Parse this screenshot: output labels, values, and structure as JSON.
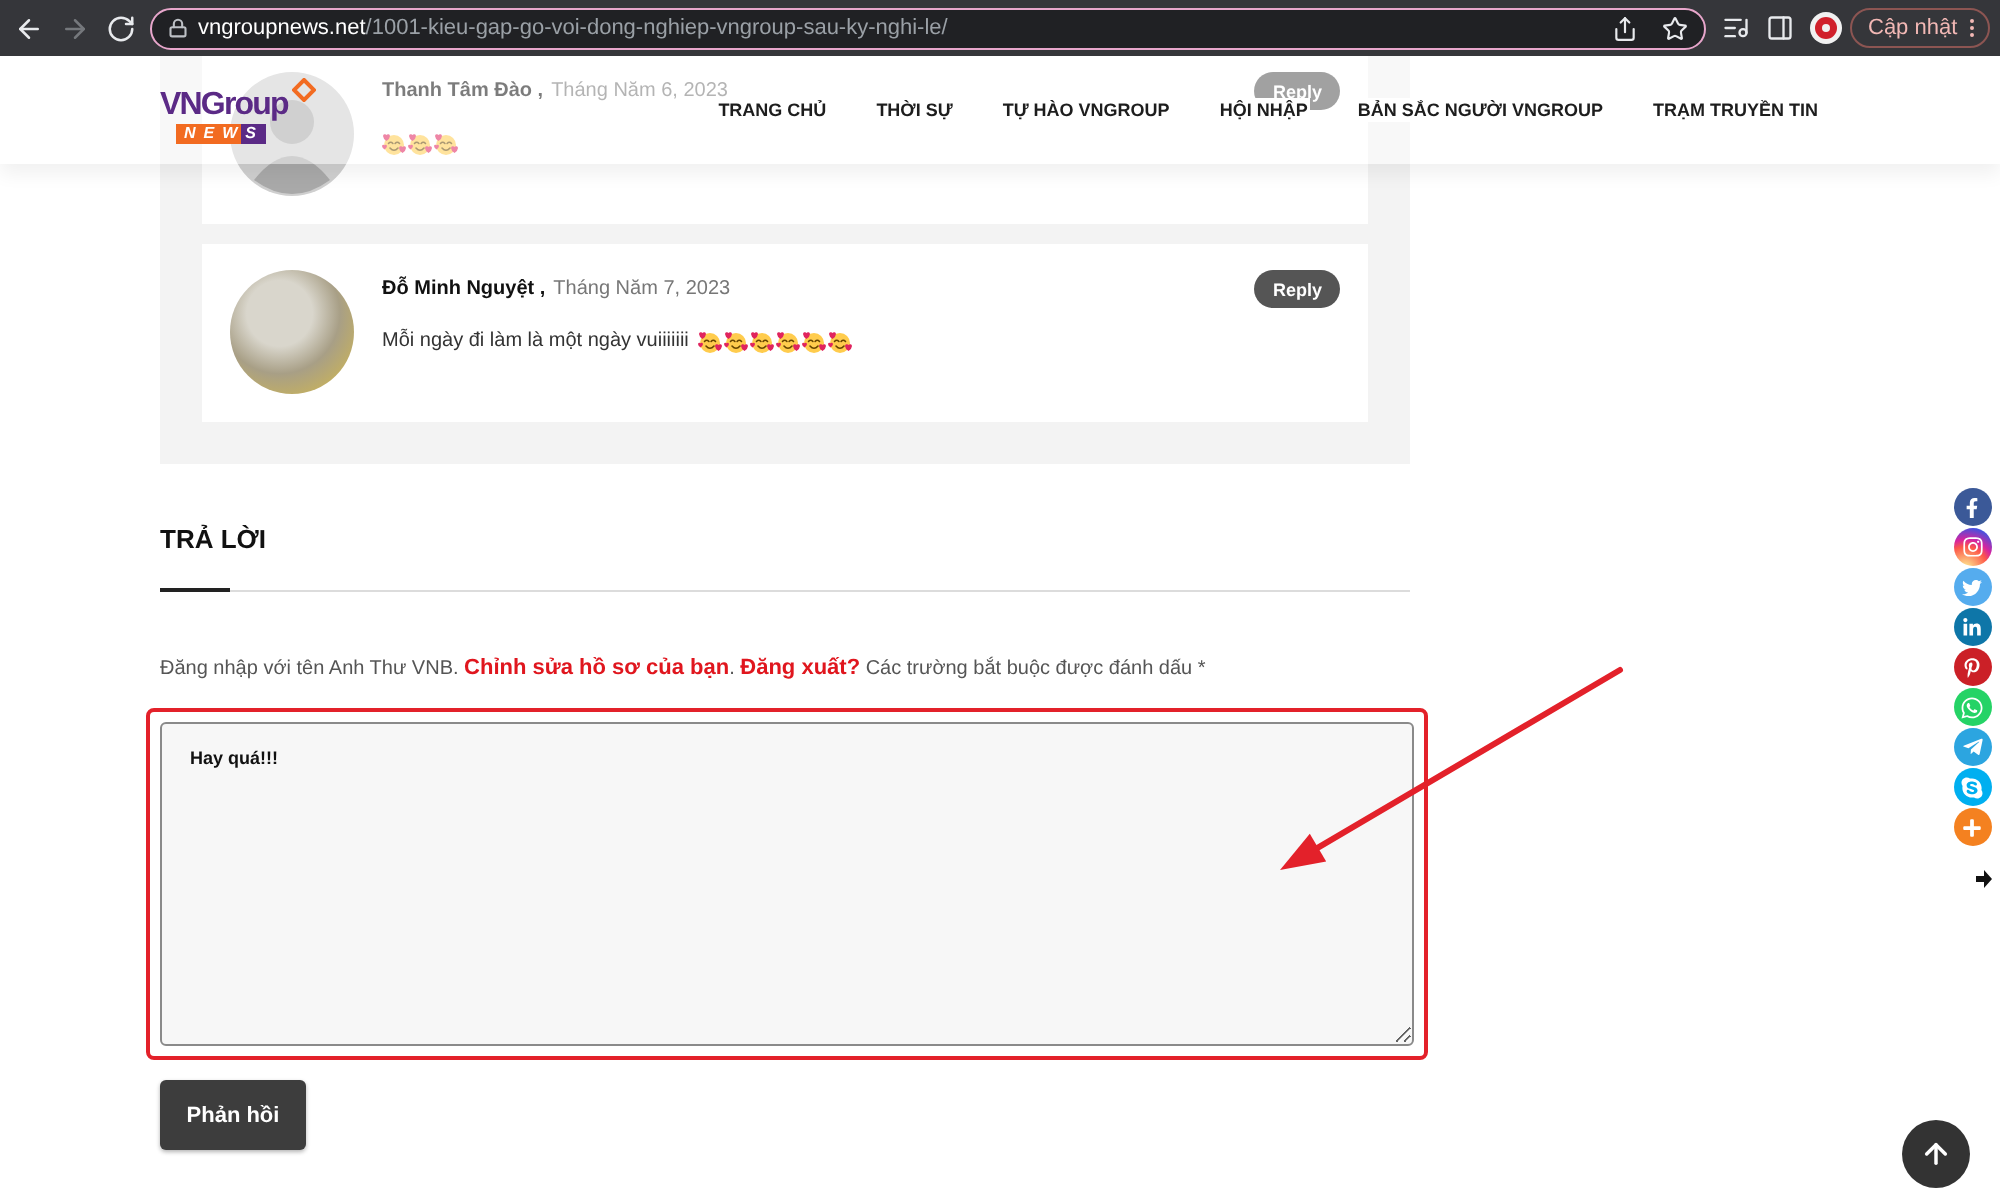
{
  "browser": {
    "nav_buttons": [
      {
        "kind": "back",
        "disabled": false
      },
      {
        "kind": "forward",
        "disabled": true
      },
      {
        "kind": "reload",
        "disabled": false
      }
    ],
    "url_domain": "vngroupnews.net",
    "url_path": "/1001-kieu-gap-go-voi-dong-nghiep-vngroup-sau-ky-nghi-le/",
    "update_button": "Cập nhật"
  },
  "header": {
    "logo": {
      "wordmark": "VNGroup",
      "tagline": "NEWS"
    },
    "nav": [
      {
        "label": "TRANG CHỦ"
      },
      {
        "label": "THỜI SỰ"
      },
      {
        "label": "TỰ HÀO VNGROUP"
      },
      {
        "label": "HỘI NHẬP"
      },
      {
        "label": "BẢN SẮC NGƯỜI VNGROUP"
      },
      {
        "label": "TRẠM TRUYỀN TIN"
      }
    ]
  },
  "comments": [
    {
      "avatar_photo": false,
      "author": "Thanh Tâm Đào ,",
      "date": "Tháng Năm 6, 2023",
      "emojis": [
        {
          "kind": "heart-face"
        },
        {
          "kind": "heart-face"
        },
        {
          "kind": "heart-face"
        }
      ],
      "reply": "Reply"
    },
    {
      "avatar_photo": true,
      "author": "Đỗ Minh Nguyệt ,",
      "date": "Tháng Năm 7, 2023",
      "text": "Mỗi ngày đi làm là một ngày vuiiiiiii",
      "emojis": [
        {
          "kind": "heart-face"
        },
        {
          "kind": "heart-face"
        },
        {
          "kind": "heart-face"
        },
        {
          "kind": "heart-face"
        },
        {
          "kind": "heart-face"
        },
        {
          "kind": "heart-face"
        }
      ],
      "reply": "Reply"
    }
  ],
  "reply_form": {
    "title": "TRẢ LỜI",
    "login_note": {
      "before": "Đăng nhập với tên Anh Thư VNB. ",
      "edit_link": "Chỉnh sửa hồ sơ của bạn",
      "between": ". ",
      "logout_link": "Đăng xuất?",
      "after": " Các trường bắt buộc được đánh dấu *"
    },
    "comment": {
      "value": "Hay quá!!!"
    },
    "submit": "Phản hồi"
  },
  "share_bar": [
    {
      "kind": "facebook"
    },
    {
      "kind": "instagram"
    },
    {
      "kind": "twitter"
    },
    {
      "kind": "linkedin"
    },
    {
      "kind": "pinterest"
    },
    {
      "kind": "whatsapp"
    },
    {
      "kind": "telegram"
    },
    {
      "kind": "skype"
    },
    {
      "kind": "more"
    }
  ],
  "annotations": {
    "frame": true,
    "arrow": true
  }
}
